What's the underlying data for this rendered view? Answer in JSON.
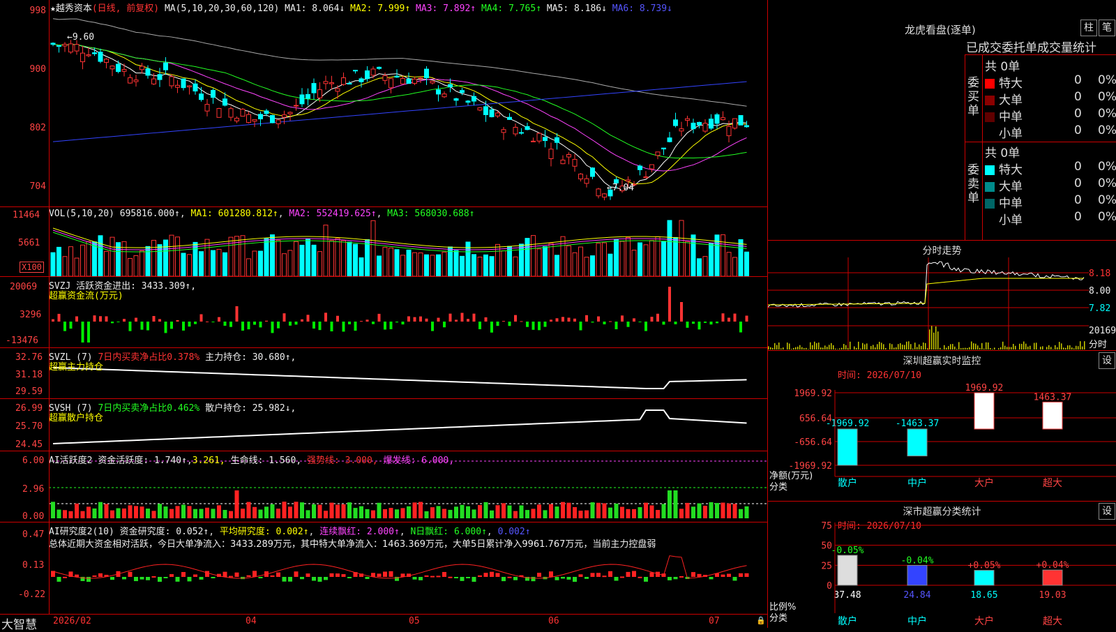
{
  "stock": {
    "name": "★越秀资本",
    "mode": "(日线, 前复权)"
  },
  "ma": {
    "title": "MA(5,10,20,30,60,120)",
    "ma1": "MA1: 8.064↓",
    "ma2": "MA2: 7.999↑",
    "ma3": "MA3: 7.892↑",
    "ma4": "MA4: 7.765↑",
    "ma5": "MA5: 8.186↓",
    "ma6": "MA6: 8.739↓"
  },
  "price_axis": [
    "998",
    "900",
    "802",
    "704"
  ],
  "price_annotations": {
    "high": "9.60",
    "low": "7.04"
  },
  "vol": {
    "title": "VOL(5,10,20)",
    "v": "695816.000↑",
    "ma1": "MA1: 601280.812↑",
    "ma2": "MA2: 552419.625↑",
    "ma3": "MA3: 568030.688↑",
    "axis": [
      "11464",
      "5661"
    ],
    "unit": "X100"
  },
  "svzj": {
    "title": "SVZJ",
    "line1": "活跃资金进出: 3433.309↑,",
    "line2": "超赢资金流(万元)",
    "axis": [
      "20069",
      "3296",
      "-13476"
    ]
  },
  "svzl": {
    "title": "SVZL (7)",
    "pct": "7日内买卖净占比0.378%",
    "hold": "主力持仓: 30.680↑,",
    "sub": "超赢主力持仓",
    "axis": [
      "32.76",
      "31.18",
      "29.59"
    ]
  },
  "svsh": {
    "title": "SVSH (7)",
    "pct": "7日内买卖净占比0.462%",
    "hold": "散户持仓: 25.982↓,",
    "sub": "超赢散户持仓",
    "axis": [
      "26.99",
      "25.70",
      "24.45"
    ]
  },
  "ai1": {
    "title": "AI活跃度2",
    "a": "资金活跃度: 1.740↑",
    "b": "3.261,",
    "c": "生命线: 1.560,",
    "d": "强势线: 3.000,",
    "e": "爆发线: 6.000,",
    "axis": [
      "6.00",
      "2.96",
      "0.00"
    ]
  },
  "ai2": {
    "title": "AI研究度2(10)",
    "a": "资金研究度: 0.052↑",
    "b": "平均研究度: 0.002↑",
    "c": "连续飘红: 2.000↑",
    "d": "N日飘红: 6.000↑",
    "e": "0.002↑",
    "summary": "总体近期大资金相对活跃，今日大单净流入：3433.289万元，其中特大单净流入：1463.369万元，大单5日累计净入9961.767万元，当前主力控盘弱",
    "axis": [
      "0.47",
      "0.13",
      "-0.22"
    ]
  },
  "xaxis": {
    "brand": "大智慧",
    "labels": [
      "2026/02",
      "04",
      "05",
      "06",
      "07"
    ]
  },
  "lhb": {
    "title": "龙虎看盘(逐单)",
    "btn_a": "柱",
    "btn_b": "笔",
    "header": "已成交委托单成交量统计",
    "buy": {
      "label": "委买单",
      "total": "共 0单",
      "rows": [
        {
          "name": "特大",
          "v": "0",
          "p": "0%",
          "c": "#ff0000"
        },
        {
          "name": "大单",
          "v": "0",
          "p": "0%",
          "c": "#8b0000"
        },
        {
          "name": "中单",
          "v": "0",
          "p": "0%",
          "c": "#600000"
        },
        {
          "name": "小单",
          "v": "0",
          "p": "0%",
          "c": ""
        }
      ]
    },
    "sell": {
      "label": "委卖单",
      "total": "共 0单",
      "rows": [
        {
          "name": "特大",
          "v": "0",
          "p": "0%",
          "c": "#00ffff"
        },
        {
          "name": "大单",
          "v": "0",
          "p": "0%",
          "c": "#008b8b"
        },
        {
          "name": "中单",
          "v": "0",
          "p": "0%",
          "c": "#006666"
        },
        {
          "name": "小单",
          "v": "0",
          "p": "0%",
          "c": ""
        }
      ]
    }
  },
  "fs": {
    "title": "分时走势",
    "axis": [
      "8.18",
      "8.00",
      "7.82"
    ],
    "vol": "20169",
    "unit": "分时"
  },
  "sz": {
    "title": "深圳超赢实时监控",
    "btn": "设",
    "time": "时间: 2026/07/10",
    "axis": [
      "1969.92",
      "656.64",
      "-656.64",
      "-1969.92"
    ],
    "values": [
      -1969.92,
      -1463.37,
      1969.92,
      1463.37
    ],
    "value_labels": [
      "-1969.92",
      "-1463.37",
      "1969.92",
      "1463.37"
    ],
    "cats": [
      "散户",
      "中户",
      "大户",
      "超大"
    ],
    "ylab1": "净额(万元)",
    "ylab2": "分类"
  },
  "cls": {
    "title": "深市超赢分类统计",
    "btn": "设",
    "time": "时间: 2026/07/10",
    "axis": [
      "75",
      "50",
      "25",
      "0"
    ],
    "values": [
      37.48,
      24.84,
      18.65,
      19.03
    ],
    "deltas": [
      "-0.05%",
      "-0.04%",
      "+0.05%",
      "+0.04%"
    ],
    "cats": [
      "散户",
      "中户",
      "大户",
      "超大"
    ],
    "ylab1": "比例%",
    "ylab2": "分类"
  },
  "colors": {
    "up": "#ff3333",
    "down": "#00ffff",
    "grid": "#cc0000"
  }
}
